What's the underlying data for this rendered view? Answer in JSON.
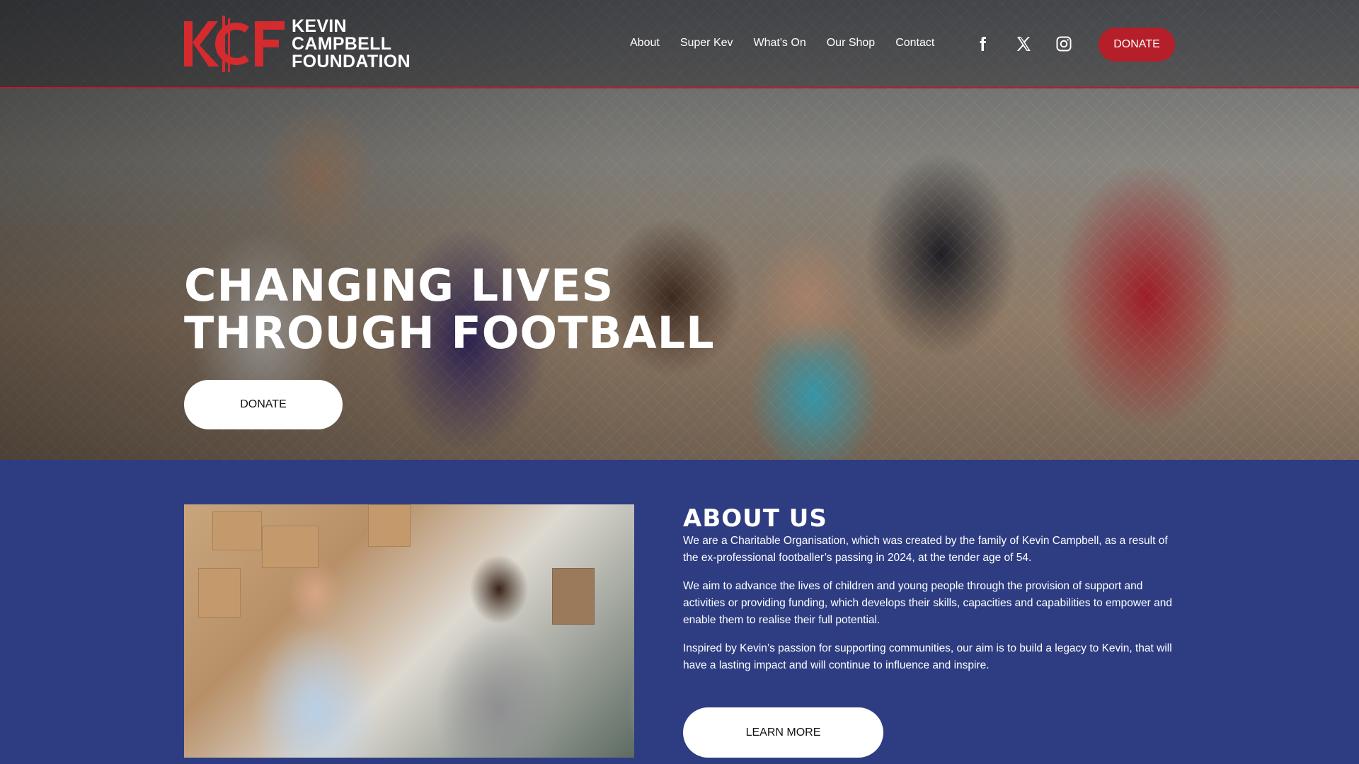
{
  "header": {
    "logo_mark": "KCF",
    "logo_lines": [
      "KEVIN",
      "CAMPBELL",
      "FOUNDATION"
    ],
    "nav": [
      "About",
      "Super Kev",
      "What's On",
      "Our Shop",
      "Contact"
    ],
    "social_icons": [
      "facebook-icon",
      "x-icon",
      "instagram-icon"
    ],
    "donate_label": "DONATE"
  },
  "hero": {
    "title_lines": [
      "CHANGING LIVES",
      "THROUGH FOOTBALL"
    ],
    "donate_label": "DONATE"
  },
  "about": {
    "heading": "ABOUT US",
    "paragraphs": [
      "We are a Charitable Organisation, which was created by the family of Kevin Campbell, as a result of the ex-professional footballer’s passing in 2024, at the tender age of 54.",
      "We aim to advance the lives of children and young people through the provision of support and activities or providing funding, which develops their skills, capacities and capabilities to empower and enable them to realise their full potential.",
      "Inspired by Kevin’s passion for supporting communities, our aim is to build a legacy to Kevin, that will have a lasting impact and will continue to influence and inspire."
    ],
    "learn_more_label": "LEARN MORE"
  },
  "colors": {
    "brand_red": "#b51f2a",
    "about_bg": "#2e3d82",
    "button_white": "#ffffff"
  }
}
